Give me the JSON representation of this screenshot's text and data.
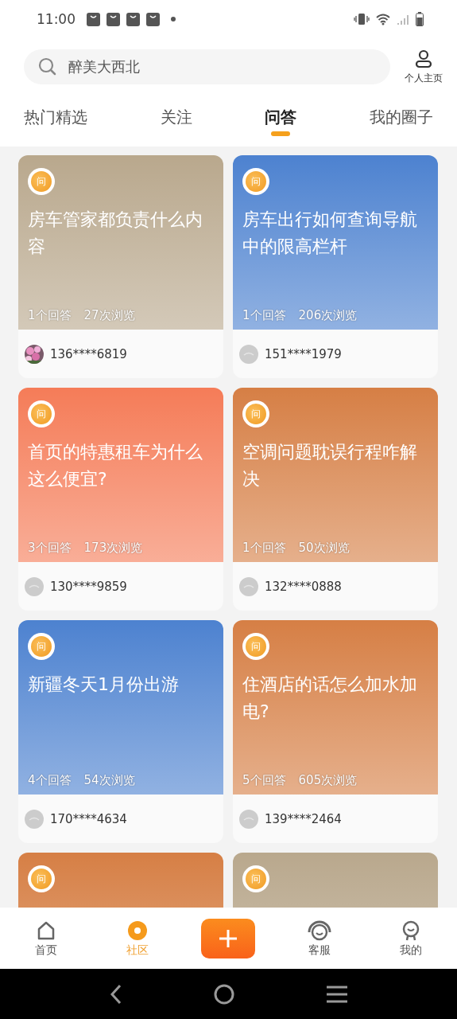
{
  "status_bar": {
    "time": "11:00"
  },
  "search": {
    "value": "醉美大西北"
  },
  "profile_link": {
    "label": "个人主页"
  },
  "tabs": [
    {
      "label": "热门精选",
      "selected": false
    },
    {
      "label": "关注",
      "selected": false
    },
    {
      "label": "问答",
      "selected": true
    },
    {
      "label": "我的圈子",
      "selected": false
    }
  ],
  "cards": [
    {
      "color": "#b9a88d",
      "badge": "问",
      "title": "房车管家都负责什么内容",
      "answers": "1个回答",
      "views": "27次浏览",
      "user": "136****6819"
    },
    {
      "color": "#4d82d0",
      "badge": "问",
      "title": "房车出行如何查询导航中的限高栏杆",
      "answers": "1个回答",
      "views": "206次浏览",
      "avatar": {
        "kind": "default"
      },
      "user": "151****1979"
    },
    {
      "color": "#f57c58",
      "badge": "问",
      "title": "首页的特惠租车为什么这么便宜?",
      "answers": "3个回答",
      "views": "173次浏览",
      "avatar": {
        "kind": "default"
      },
      "user": "130****9859"
    },
    {
      "color": "#d67f45",
      "badge": "问",
      "title": "空调问题耽误行程咋解决",
      "answers": "1个回答",
      "views": "50次浏览",
      "avatar": {
        "kind": "default"
      },
      "user": "132****0888"
    },
    {
      "color": "#4d82d0",
      "badge": "问",
      "title": "新疆冬天1月份出游",
      "answers": "4个回答",
      "views": "54次浏览",
      "avatar": {
        "kind": "default"
      },
      "user": "170****4634"
    },
    {
      "color": "#d67f45",
      "badge": "问",
      "title": "住酒店的话怎么加水加电?",
      "answers": "5个回答",
      "views": "605次浏览",
      "avatar": {
        "kind": "default"
      },
      "user": "139****2464"
    },
    {
      "color": "#d67f45",
      "badge": "问"
    },
    {
      "color": "#b9a88d",
      "badge": "问"
    }
  ],
  "bottom_nav": [
    {
      "kind": "home",
      "label": "首页",
      "selected": false
    },
    {
      "kind": "community",
      "label": "社区",
      "selected": true
    },
    {
      "kind": "add"
    },
    {
      "kind": "service",
      "label": "客服",
      "selected": false
    },
    {
      "kind": "me",
      "label": "我的",
      "selected": false
    }
  ]
}
